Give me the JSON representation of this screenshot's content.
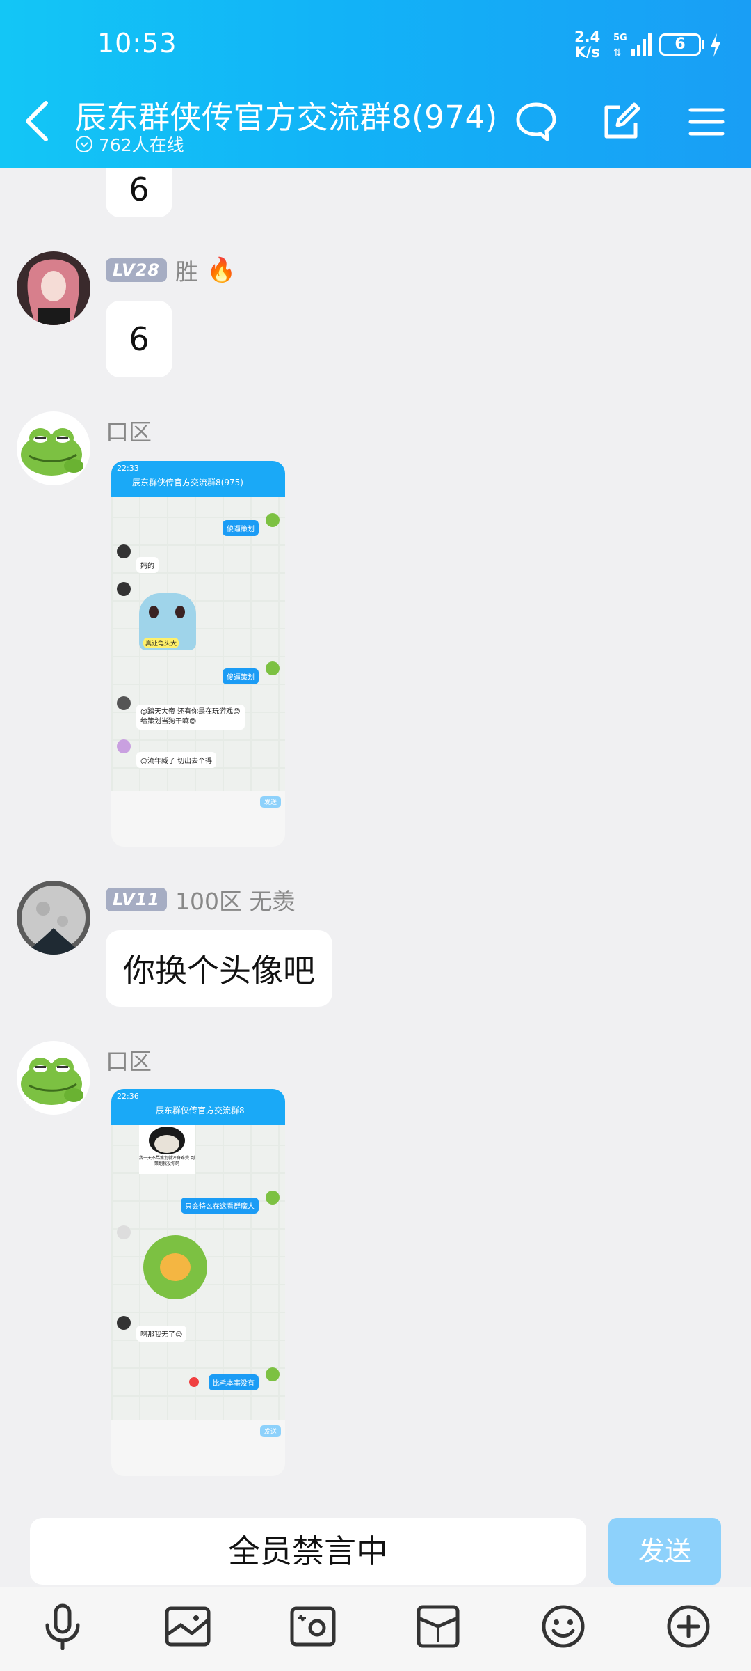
{
  "status_bar": {
    "time": "10:53",
    "net_speed": "2.4",
    "net_unit": "K/s",
    "network": "5G",
    "battery": "6"
  },
  "header": {
    "title": "辰东群侠传官方交流群8(974)",
    "online": "762人在线"
  },
  "messages": [
    {
      "text": "6"
    },
    {
      "level": "LV28",
      "name": "胜",
      "text": "6"
    },
    {
      "name": "口区",
      "screenshot": {
        "time": "22:33",
        "title": "辰东群侠传官方交流群8(975)",
        "msgs": [
          "傻逼策划",
          "妈的",
          "真让龟头大",
          "傻逼策划",
          "@踏天大帝 还有你是在玩游戏😊",
          "给策划当狗干嘛😊",
          "@流年臧了 切出去个得"
        ],
        "send": "发送"
      }
    },
    {
      "level": "LV11",
      "name": "100区  无羡",
      "text": "你换个头像吧"
    },
    {
      "name": "口区",
      "screenshot": {
        "time": "22:36",
        "title": "辰东群侠传官方交流群8",
        "msgs": [
          "我一天不骂策划就浑身难受 到策划我投你码",
          "只会特么在这看群魔人",
          "啊那我无了😊",
          "比毛本事没有"
        ],
        "send": "发送"
      }
    }
  ],
  "input": {
    "placeholder": "全员禁言中",
    "send_label": "发送"
  },
  "toolbar": [
    "mic-icon",
    "gallery-icon",
    "camera-icon",
    "red-packet-icon",
    "emoji-icon",
    "plus-icon"
  ]
}
